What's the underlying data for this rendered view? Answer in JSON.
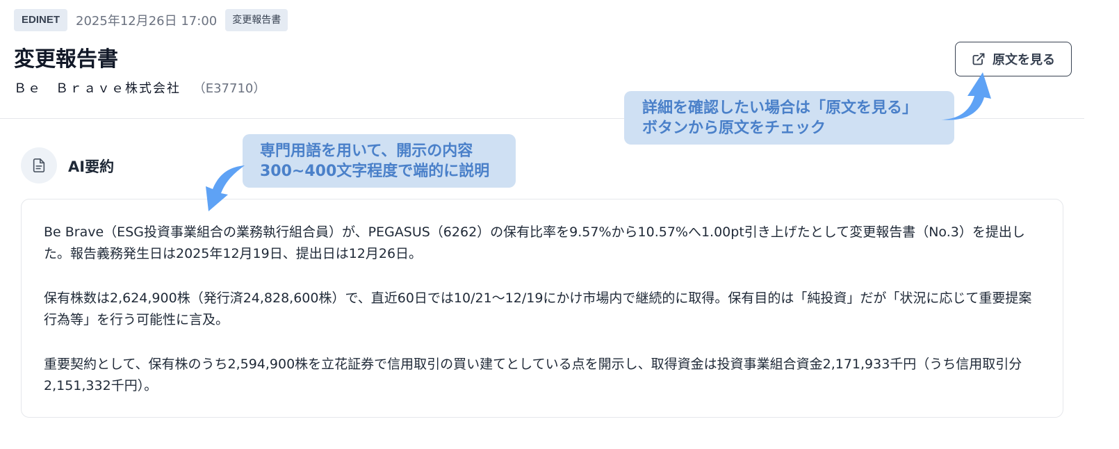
{
  "header": {
    "source_badge": "EDINET",
    "datetime": "2025年12月26日 17:00",
    "type_badge": "変更報告書",
    "title": "変更報告書",
    "company_name": "Ｂｅ　Ｂｒａｖｅ株式会社",
    "company_code": "（E37710）",
    "open_original_label": "原文を見る"
  },
  "ai_summary": {
    "title": "AI要約",
    "paragraphs": [
      "Be Brave（ESG投資事業組合の業務執行組合員）が、PEGASUS（6262）の保有比率を9.57%から10.57%へ1.00pt引き上げたとして変更報告書（No.3）を提出した。報告義務発生日は2025年12月19日、提出日は12月26日。",
      "保有株数は2,624,900株（発行済24,828,600株）で、直近60日では10/21〜12/19にかけ市場内で継続的に取得。保有目的は「純投資」だが「状況に応じて重要提案行為等」を行う可能性に言及。",
      "重要契約として、保有株のうち2,594,900株を立花証券で信用取引の買い建てとしている点を開示し、取得資金は投資事業組合資金2,171,933千円（うち信用取引分2,151,332千円）。"
    ]
  },
  "callouts": {
    "summary_line1": "専門用語を用いて、開示の内容",
    "summary_line2": "300~400文字程度で端的に説明",
    "original_line1": "詳細を確認したい場合は「原文を見る」",
    "original_line2": "ボタンから原文をチェック"
  },
  "icons": {
    "external_link": "external-link-icon",
    "document": "document-icon",
    "arrow": "curved-arrow-icon"
  },
  "colors": {
    "callout_bg": "#cfe0f3",
    "callout_text": "#4a80c9",
    "arrow": "#5ea2f5",
    "badge_bg": "#e5ebf3"
  }
}
